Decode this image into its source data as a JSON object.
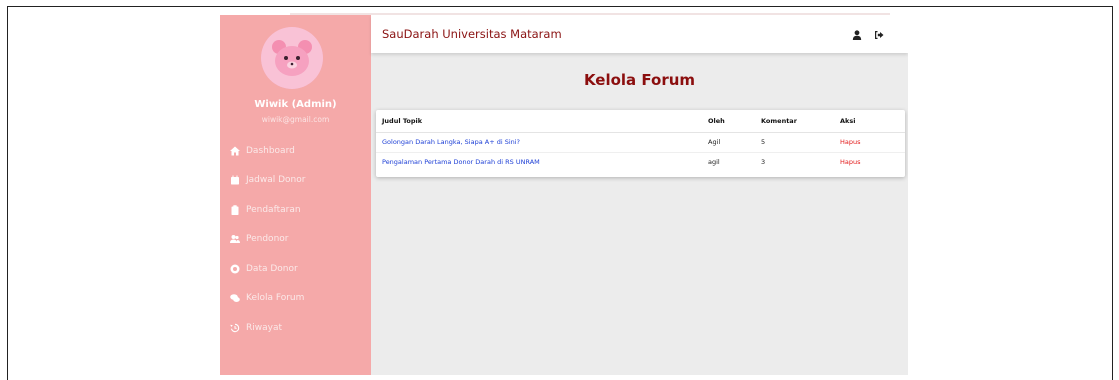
{
  "header": {
    "title": "SauDarah Universitas Mataram",
    "user_icon": "user-icon",
    "logout_icon": "logout-icon"
  },
  "profile": {
    "name": "Wiwik (Admin)",
    "email": "wiwik@gmail.com",
    "avatar": "pink-bear-avatar"
  },
  "sidebar": {
    "items": [
      {
        "label": "Dashboard",
        "icon": "home-icon"
      },
      {
        "label": "Jadwal Donor",
        "icon": "calendar-icon"
      },
      {
        "label": "Pendaftaran",
        "icon": "clipboard-icon"
      },
      {
        "label": "Pendonor",
        "icon": "users-icon"
      },
      {
        "label": "Data Donor",
        "icon": "database-icon"
      },
      {
        "label": "Kelola Forum",
        "icon": "comments-icon"
      },
      {
        "label": "Riwayat",
        "icon": "history-icon"
      }
    ]
  },
  "main": {
    "page_title": "Kelola Forum",
    "table": {
      "headers": [
        "Judul Topik",
        "Oleh",
        "Komentar",
        "Aksi"
      ],
      "rows": [
        {
          "topic": "Golongan Darah Langka, Siapa A+ di Sini?",
          "by": "Agil",
          "comments": "5",
          "action": "Hapus"
        },
        {
          "topic": "Pengalaman Pertama Donor Darah di RS UNRAM",
          "by": "agil",
          "comments": "3",
          "action": "Hapus"
        }
      ]
    }
  },
  "colors": {
    "sidebar": "#f5a9a9",
    "title": "#8b0e0e",
    "link": "#1d3fd6",
    "danger": "#e21b1b"
  }
}
